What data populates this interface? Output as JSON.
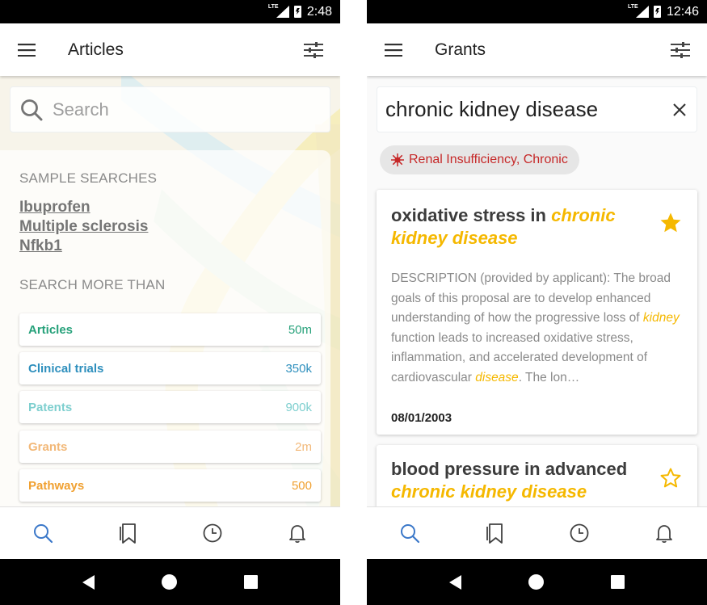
{
  "left": {
    "status": {
      "network": "LTE",
      "time": "2:48"
    },
    "app_bar": {
      "title": "Articles"
    },
    "search": {
      "placeholder": "Search"
    },
    "sample_searches": {
      "heading": "SAMPLE SEARCHES",
      "items": [
        "Ibuprofen",
        "Multiple sclerosis",
        "Nfkb1"
      ]
    },
    "search_more": {
      "heading": "SEARCH MORE THAN",
      "categories": [
        {
          "name": "Articles",
          "count": "50m",
          "color": "#26a17a"
        },
        {
          "name": "Clinical trials",
          "count": "350k",
          "color": "#2e8fbd"
        },
        {
          "name": "Patents",
          "count": "900k",
          "color": "#7ecfcf"
        },
        {
          "name": "Grants",
          "count": "2m",
          "color": "#f2b878"
        },
        {
          "name": "Pathways",
          "count": "500",
          "color": "#f0a030"
        }
      ]
    },
    "bottom_nav": [
      "search-icon",
      "bookmarks-icon",
      "history-icon",
      "notifications-icon"
    ]
  },
  "right": {
    "status": {
      "network": "LTE",
      "time": "12:46"
    },
    "app_bar": {
      "title": "Grants"
    },
    "query": "chronic kidney disease",
    "chip": {
      "label": "Renal Insufficiency, Chronic",
      "icon": "virus-icon"
    },
    "results": [
      {
        "title_plain": "oxidative stress in ",
        "title_highlight": "chronic kidney disease",
        "starred": true,
        "desc_part1": "DESCRIPTION (provided by applicant): The broad goals of this proposal are to develop enhanced understanding of how the progressive loss of ",
        "desc_hl1": "kidney",
        "desc_part2": " function leads to increased oxidative stress, inflammation, and accelerated development of cardiovascular ",
        "desc_hl2": "disease",
        "desc_part3": ". The lon…",
        "date": "08/01/2003"
      },
      {
        "title_plain": "blood pressure in advanced ",
        "title_highlight": "chronic kidney disease",
        "starred": false
      }
    ],
    "bottom_nav": [
      "search-icon",
      "bookmarks-icon",
      "history-icon",
      "notifications-icon"
    ]
  },
  "colors": {
    "accent_blue": "#3b78c9",
    "highlight_yellow": "#f5b800",
    "chip_red": "#c62828"
  }
}
